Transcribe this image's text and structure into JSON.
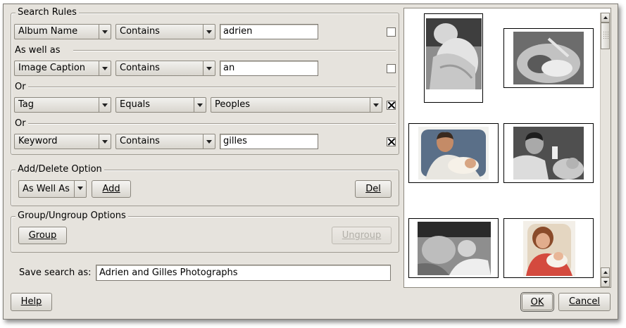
{
  "search_rules": {
    "title": "Search Rules",
    "rules": [
      {
        "field": "Album Name",
        "operator": "Contains",
        "value": "adrien",
        "checked": false
      },
      {
        "field": "Image Caption",
        "operator": "Contains",
        "value": "an",
        "checked": false
      },
      {
        "field": "Tag",
        "operator": "Equals",
        "value": "Peoples",
        "checked": true
      },
      {
        "field": "Keyword",
        "operator": "Contains",
        "value": "gilles",
        "checked": true
      }
    ],
    "connectors": [
      "As well as",
      "Or",
      "Or"
    ]
  },
  "add_delete": {
    "title": "Add/Delete Option",
    "option_value": "As Well As",
    "add_label": "Add",
    "del_label": "Del"
  },
  "group_ungroup": {
    "title": "Group/Ungroup Options",
    "group_label": "Group",
    "ungroup_label": "Ungroup"
  },
  "save": {
    "label": "Save search as:",
    "value": "Adrien and Gilles Photographs"
  },
  "buttons": {
    "help": "Help",
    "ok": "OK",
    "cancel": "Cancel"
  },
  "gallery": {
    "thumbnails": [
      {
        "name": "baby-sleeping-grayscale"
      },
      {
        "name": "baby-in-incubator-grayscale"
      },
      {
        "name": "man-feeding-baby-color"
      },
      {
        "name": "man-feeding-baby-grayscale"
      },
      {
        "name": "baby-sleeping-with-adult-grayscale"
      },
      {
        "name": "grandmother-with-baby-color"
      }
    ]
  }
}
